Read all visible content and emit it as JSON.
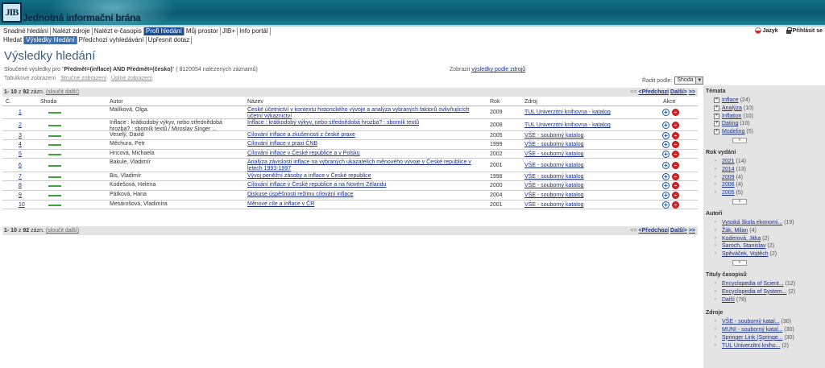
{
  "header": {
    "logo_text": "JIB",
    "site_title": "Jednotná informační brána",
    "language_label": "Jazyk",
    "login_label": "Přihlásit se"
  },
  "nav_main": [
    {
      "label": "Snadné hledání",
      "active": false
    },
    {
      "label": "Nalézt zdroje",
      "active": false
    },
    {
      "label": "Nalézt e-časopis",
      "active": false
    },
    {
      "label": "Profi hledání",
      "active": true
    },
    {
      "label": "Můj prostor",
      "active": false
    },
    {
      "label": "JIB+",
      "active": false
    },
    {
      "label": "Info portál",
      "active": false
    }
  ],
  "nav_sub": [
    {
      "label": "Hledat",
      "active": false
    },
    {
      "label": "Výsledky hledání",
      "active": true
    },
    {
      "label": "Předchozí vyhledávání",
      "active": false
    },
    {
      "label": "Upřesnit dotaz",
      "active": false
    }
  ],
  "page": {
    "title": "Výsledky hledání",
    "summary_prefix": "Sloučené výsledky pro \"",
    "summary_query": "Předmět=(inflace) AND Předmět=(česko)",
    "summary_suffix": "\" ( 8120054 nalezených záznamů)",
    "by_source_prefix": "Zobrazit",
    "by_source_link": "výsledky podle zdrojů",
    "views": [
      "Tabulkové zobrazení",
      "Stručné zobrazení",
      "Úplné zobrazení"
    ],
    "sort_label": "Řadit podle:",
    "sort_value": "Shoda"
  },
  "paging": {
    "range": "1- 10",
    "of_label": "z",
    "total": "92",
    "unit": "zázn.",
    "merge_link": "(sloučit další)",
    "prev_arrows": "<<",
    "prev_label": "<Předchozí",
    "next_label": "Další>",
    "next_arrows": ">>"
  },
  "table": {
    "headers": {
      "num": "Č.",
      "match": "Shoda",
      "author": "Autor",
      "title": "Název",
      "year": "Rok",
      "source": "Zdroj",
      "action": "Akce"
    },
    "rows": [
      {
        "num": "1",
        "author": "Malíková, Olga.",
        "title": "České účetnictví v kontextu historického vývoje a analýza vybraných faktorů ovlivňujících účetní výkaznictví",
        "year": "2009",
        "source": "TUL Univerzitní knihovna - katalog"
      },
      {
        "num": "2",
        "author": "Inflace : krátkodobý výkyv, nebo střednědobá hrozba? : sborník textů / Miroslav Singer ...",
        "title": "Inflace : krátkodobý výkyv, nebo střednědobá hrozba? : sborník textů",
        "year": "2008",
        "source": "TUL Univerzitní knihovna - katalog"
      },
      {
        "num": "3",
        "author": "Veselý, David",
        "title": "Cílování inflace a zkušenosti z české praxe",
        "year": "2005",
        "source": "VŠE - souborný katalog"
      },
      {
        "num": "4",
        "author": "Měchura, Petr",
        "title": "Cílování inflace v praxi ČNB",
        "year": "1999",
        "source": "VŠE - souborný katalog"
      },
      {
        "num": "5",
        "author": "Hricová, Michaela",
        "title": "Cílování inflace v České republice a v Polsku",
        "year": "2002",
        "source": "VŠE - souborný katalog"
      },
      {
        "num": "6",
        "author": "Bakule, Vladimír",
        "title": "Analýza závislosti inflace na vybraných ukazatelích měnového vývoje v České republice v letech 1993-1997",
        "year": "2001",
        "source": "VŠE - souborný katalog"
      },
      {
        "num": "7",
        "author": "Bis, Vladimír",
        "title": "Vývoj peněžní zásoby a inflace v České republice",
        "year": "1998",
        "source": "VŠE - souborný katalog"
      },
      {
        "num": "8",
        "author": "Kodešová, Helena",
        "title": "Cílování inflace v České republice a na Novém Zélandu",
        "year": "2000",
        "source": "VŠE - souborný katalog"
      },
      {
        "num": "9",
        "author": "Pátková, Hana",
        "title": "Diskuse úspěšnosti režimu cílování inflace",
        "year": "2004",
        "source": "VŠE - souborný katalog"
      },
      {
        "num": "10",
        "author": "Mesárošová, Vladimíra",
        "title": "Měnové cíle a inflace v ČR",
        "year": "2001",
        "source": "VŠE - souborný katalog"
      }
    ]
  },
  "sidebar": {
    "more_label": "v",
    "facets": [
      {
        "title": "Témata",
        "marker": "plus",
        "more": true,
        "items": [
          {
            "label": "Inflace",
            "count": "(24)"
          },
          {
            "label": "Analýza",
            "count": "(10)"
          },
          {
            "label": "Inflation",
            "count": "(10)"
          },
          {
            "label": "Dating",
            "count": "(10)"
          },
          {
            "label": "Modeling",
            "count": "(5)"
          }
        ]
      },
      {
        "title": "Rok vydání",
        "marker": "arrow",
        "more": true,
        "items": [
          {
            "label": "2021",
            "count": "(14)"
          },
          {
            "label": "2014",
            "count": "(13)"
          },
          {
            "label": "2009",
            "count": "(4)"
          },
          {
            "label": "2006",
            "count": "(4)"
          },
          {
            "label": "2005",
            "count": "(5)"
          }
        ]
      },
      {
        "title": "Autoři",
        "marker": "arrow",
        "more": true,
        "items": [
          {
            "label": "Vysoká škola ekonomi...",
            "count": "(19)"
          },
          {
            "label": "Žák, Milan",
            "count": "(4)"
          },
          {
            "label": "Koderová, Jitka",
            "count": "(2)"
          },
          {
            "label": "Šaroch, Stanislav",
            "count": "(2)"
          },
          {
            "label": "Spěváček, Vojtěch",
            "count": "(2)"
          }
        ]
      },
      {
        "title": "Tituly časopisů",
        "marker": "arrow",
        "more": false,
        "items": [
          {
            "label": "Encyclopedia of Scient...",
            "count": "(12)"
          },
          {
            "label": "Encyclopedia of System...",
            "count": "(2)"
          },
          {
            "label": "Další",
            "count": "(78)"
          }
        ]
      },
      {
        "title": "Zdroje",
        "marker": "arrow",
        "more": false,
        "items": [
          {
            "label": "VŠE - souborný katal...",
            "count": "(30)"
          },
          {
            "label": "MUNI - souborný katal...",
            "count": "(30)"
          },
          {
            "label": "Springer Link (Springe...",
            "count": "(30)"
          },
          {
            "label": "TUL Univerzitní kniho...",
            "count": "(2)"
          }
        ]
      }
    ]
  }
}
